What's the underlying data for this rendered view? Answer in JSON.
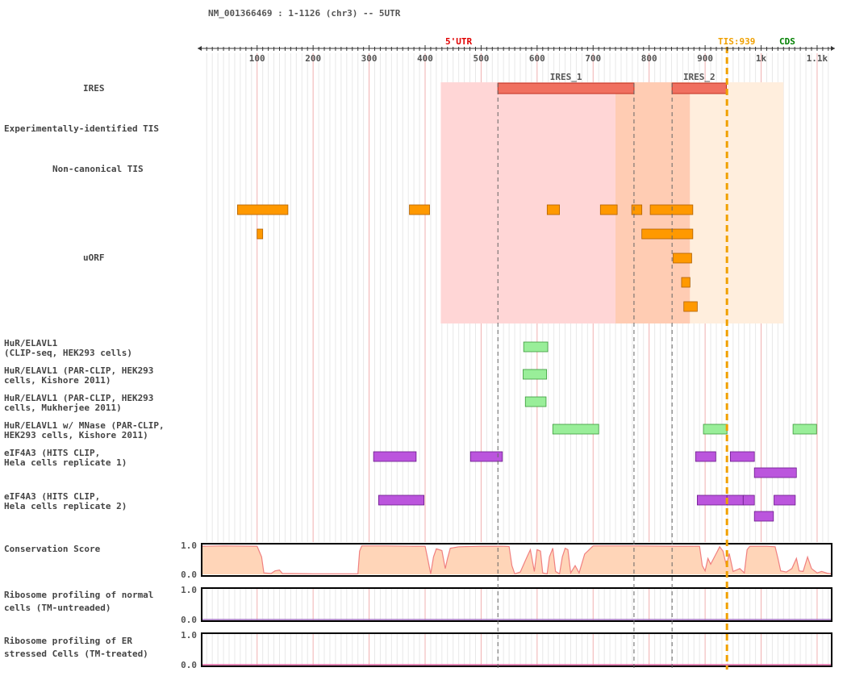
{
  "header": {
    "title": "NM_001366469 : 1-1126 (chr3) -- 5UTR"
  },
  "markers": {
    "utr_label": "5'UTR",
    "tis_label": "TIS:939",
    "cds_label": "CDS",
    "utr_color": "#e00000",
    "tis_color": "#f0a000",
    "cds_color": "#008000"
  },
  "track_labels": {
    "ires": "IRES",
    "exp_tis": "Experimentally-identified TIS",
    "noncanonical_tis": "Non-canonical TIS",
    "uorf": "uORF",
    "hur1": [
      "HuR/ELAVL1",
      "(CLIP-seq, HEK293 cells)"
    ],
    "hur2": [
      "HuR/ELAVL1 (PAR-CLIP, HEK293",
      "cells, Kishore 2011)"
    ],
    "hur3": [
      "HuR/ELAVL1 (PAR-CLIP, HEK293",
      "cells, Mukherjee 2011)"
    ],
    "hur4": [
      "HuR/ELAVL1 w/ MNase (PAR-CLIP,",
      "HEK293 cells, Kishore 2011)"
    ],
    "eif1": [
      "eIF4A3 (HITS CLIP,",
      "Hela cells replicate 1)"
    ],
    "eif2": [
      "eIF4A3 (HITS CLIP,",
      "Hela cells replicate 2)"
    ],
    "cons": "Conservation Score",
    "ribo_normal": [
      "Ribosome profiling of normal",
      "cells (TM-untreaded)"
    ],
    "ribo_er": [
      "Ribosome profiling of ER",
      "stressed Cells (TM-treated)"
    ]
  },
  "chart_data": {
    "type": "genome-track",
    "title": "NM_001366469 : 1-1126 (chr3) -- 5UTR",
    "x_range": [
      1,
      1126
    ],
    "ticks": [
      {
        "value": 100,
        "label": "100"
      },
      {
        "value": 200,
        "label": "200"
      },
      {
        "value": 300,
        "label": "300"
      },
      {
        "value": 400,
        "label": "400"
      },
      {
        "value": 500,
        "label": "500"
      },
      {
        "value": 600,
        "label": "600"
      },
      {
        "value": 700,
        "label": "700"
      },
      {
        "value": 800,
        "label": "800"
      },
      {
        "value": 900,
        "label": "900"
      },
      {
        "value": 1000,
        "label": "1k"
      },
      {
        "value": 1100,
        "label": "1.1k"
      }
    ],
    "tis_position": 939,
    "ires": [
      {
        "name": "IRES_1",
        "start": 530,
        "end": 773
      },
      {
        "name": "IRES_2",
        "start": 841,
        "end": 938
      }
    ],
    "ires_shading": [
      {
        "start": 428,
        "end": 740,
        "color": "#ffd6d6"
      },
      {
        "start": 740,
        "end": 873,
        "color": "#ffccb3"
      },
      {
        "start": 873,
        "end": 1040,
        "color": "#ffeedd"
      }
    ],
    "guide_lines": [
      530,
      773,
      841
    ],
    "uorf": [
      {
        "row": 0,
        "start": 65,
        "end": 155
      },
      {
        "row": 0,
        "start": 372,
        "end": 408
      },
      {
        "row": 0,
        "start": 618,
        "end": 640
      },
      {
        "row": 0,
        "start": 713,
        "end": 743
      },
      {
        "row": 0,
        "start": 769,
        "end": 787
      },
      {
        "row": 0,
        "start": 802,
        "end": 878
      },
      {
        "row": 1,
        "start": 100,
        "end": 110
      },
      {
        "row": 1,
        "start": 787,
        "end": 878
      },
      {
        "row": 2,
        "start": 843,
        "end": 876
      },
      {
        "row": 3,
        "start": 858,
        "end": 873
      },
      {
        "row": 4,
        "start": 862,
        "end": 886
      }
    ],
    "hur_clip": [
      {
        "start": 576,
        "end": 619
      }
    ],
    "hur_parclip_kishore": [
      {
        "start": 575,
        "end": 617
      }
    ],
    "hur_parclip_mukherjee": [
      {
        "start": 579,
        "end": 616
      }
    ],
    "hur_mnase": [
      {
        "start": 628,
        "end": 710
      },
      {
        "start": 897,
        "end": 939
      },
      {
        "start": 1057,
        "end": 1099
      }
    ],
    "eif4a3_rep1": [
      {
        "row": 0,
        "start": 308,
        "end": 384
      },
      {
        "row": 0,
        "start": 481,
        "end": 538
      },
      {
        "row": 0,
        "start": 883,
        "end": 919
      },
      {
        "row": 0,
        "start": 945,
        "end": 988
      },
      {
        "row": 1,
        "start": 988,
        "end": 1063
      }
    ],
    "eif4a3_rep2": [
      {
        "row": 0,
        "start": 317,
        "end": 398
      },
      {
        "row": 0,
        "start": 886,
        "end": 939
      },
      {
        "row": 0,
        "start": 939,
        "end": 968
      },
      {
        "row": 0,
        "start": 968,
        "end": 988
      },
      {
        "row": 0,
        "start": 1023,
        "end": 1061
      },
      {
        "row": 1,
        "start": 988,
        "end": 1022
      }
    ],
    "conservation": {
      "ylim": [
        0,
        1
      ],
      "ytick_labels": [
        "1.0",
        "0.0"
      ],
      "points": [
        [
          1,
          0.97
        ],
        [
          40,
          0.98
        ],
        [
          100,
          0.97
        ],
        [
          108,
          0.6
        ],
        [
          112,
          0.05
        ],
        [
          125,
          0.03
        ],
        [
          132,
          0.12
        ],
        [
          140,
          0.15
        ],
        [
          145,
          0.03
        ],
        [
          200,
          0.02
        ],
        [
          250,
          0.02
        ],
        [
          280,
          0.02
        ],
        [
          283,
          0.8
        ],
        [
          287,
          0.98
        ],
        [
          330,
          0.98
        ],
        [
          380,
          0.97
        ],
        [
          400,
          0.97
        ],
        [
          405,
          0.5
        ],
        [
          410,
          0.02
        ],
        [
          415,
          0.6
        ],
        [
          420,
          0.88
        ],
        [
          430,
          0.82
        ],
        [
          436,
          0.2
        ],
        [
          440,
          0.55
        ],
        [
          445,
          0.9
        ],
        [
          460,
          0.95
        ],
        [
          500,
          0.97
        ],
        [
          540,
          0.97
        ],
        [
          550,
          0.96
        ],
        [
          555,
          0.3
        ],
        [
          560,
          0.02
        ],
        [
          570,
          0.08
        ],
        [
          582,
          0.6
        ],
        [
          588,
          0.85
        ],
        [
          595,
          0.1
        ],
        [
          600,
          0.85
        ],
        [
          606,
          0.8
        ],
        [
          610,
          0.05
        ],
        [
          618,
          0.02
        ],
        [
          622,
          0.6
        ],
        [
          628,
          0.9
        ],
        [
          633,
          0.1
        ],
        [
          640,
          0.02
        ],
        [
          645,
          0.6
        ],
        [
          650,
          0.9
        ],
        [
          655,
          0.85
        ],
        [
          660,
          0.05
        ],
        [
          668,
          0.3
        ],
        [
          675,
          0.05
        ],
        [
          685,
          0.7
        ],
        [
          700,
          0.98
        ],
        [
          780,
          0.98
        ],
        [
          850,
          0.97
        ],
        [
          890,
          0.97
        ],
        [
          895,
          0.3
        ],
        [
          900,
          0.12
        ],
        [
          905,
          0.55
        ],
        [
          910,
          0.35
        ],
        [
          918,
          0.65
        ],
        [
          926,
          0.95
        ],
        [
          932,
          0.8
        ],
        [
          938,
          0.3
        ],
        [
          943,
          0.72
        ],
        [
          950,
          0.1
        ],
        [
          962,
          0.2
        ],
        [
          970,
          0.05
        ],
        [
          975,
          0.85
        ],
        [
          980,
          0.97
        ],
        [
          1010,
          0.97
        ],
        [
          1025,
          0.95
        ],
        [
          1030,
          0.55
        ],
        [
          1035,
          0.12
        ],
        [
          1045,
          0.08
        ],
        [
          1055,
          0.2
        ],
        [
          1063,
          0.55
        ],
        [
          1068,
          0.12
        ],
        [
          1075,
          0.1
        ],
        [
          1083,
          0.6
        ],
        [
          1090,
          0.2
        ],
        [
          1100,
          0.05
        ],
        [
          1108,
          0.1
        ],
        [
          1118,
          0.04
        ],
        [
          1126,
          0.02
        ]
      ]
    },
    "ribo_normal": {
      "ylim": [
        0,
        1
      ],
      "ytick_labels": [
        "1.0",
        "0.0"
      ],
      "value": 0.0,
      "color": "#a070c0"
    },
    "ribo_er": {
      "ylim": [
        0,
        1
      ],
      "ytick_labels": [
        "1.0",
        "0.0"
      ],
      "value": 0.0,
      "color": "#e060a0"
    }
  },
  "colors": {
    "ires_bar": "#f07060",
    "uorf": "#ff9900",
    "hur": "#99ee99",
    "eif4a3": "#bb55dd",
    "conservation_fill": "#ffd5b8",
    "conservation_line": "#f08080",
    "gridline_minor": "#e8e8e8",
    "gridline_major": "#f0b0b0",
    "tis_line": "#f0a000"
  }
}
